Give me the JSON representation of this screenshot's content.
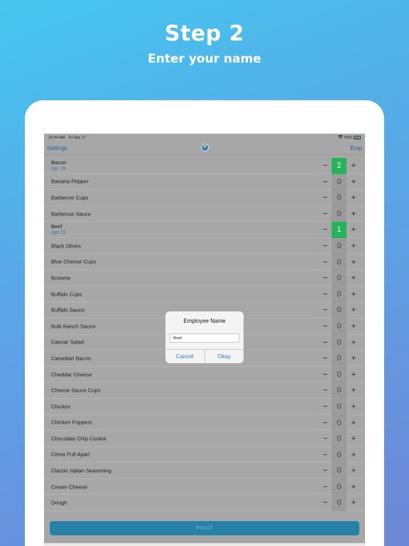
{
  "hero": {
    "title": "Step 2",
    "subtitle": "Enter your name"
  },
  "status_bar": {
    "time": "10:44 AM",
    "date": "Fri Apr 17",
    "battery": "59%"
  },
  "nav": {
    "left_label": "Settings",
    "right_label": "Emp"
  },
  "items": [
    {
      "name": "Bacon",
      "date": "Apr 16",
      "count": "2",
      "active": true
    },
    {
      "name": "Banana Pepper",
      "date": "",
      "count": "0",
      "active": false
    },
    {
      "name": "Barbecue Cups",
      "date": "",
      "count": "0",
      "active": false
    },
    {
      "name": "Barbecue Sauce",
      "date": "",
      "count": "0",
      "active": false
    },
    {
      "name": "Beef",
      "date": "Apr 15",
      "count": "1",
      "active": true
    },
    {
      "name": "Black Olives",
      "date": "",
      "count": "0",
      "active": false
    },
    {
      "name": "Blue Cheese Cups",
      "date": "",
      "count": "0",
      "active": false
    },
    {
      "name": "Brownie",
      "date": "",
      "count": "0",
      "active": false
    },
    {
      "name": "Buffalo Cups",
      "date": "",
      "count": "0",
      "active": false
    },
    {
      "name": "Buffalo Sauce",
      "date": "",
      "count": "0",
      "active": false
    },
    {
      "name": "Bulk Ranch Sauce",
      "date": "",
      "count": "0",
      "active": false
    },
    {
      "name": "Caesar Salad",
      "date": "",
      "count": "0",
      "active": false
    },
    {
      "name": "Canadian Bacon",
      "date": "",
      "count": "0",
      "active": false
    },
    {
      "name": "Cheddar Cheese",
      "date": "",
      "count": "0",
      "active": false
    },
    {
      "name": "Cheese Sauce Cups",
      "date": "",
      "count": "0",
      "active": false
    },
    {
      "name": "Chicken",
      "date": "",
      "count": "0",
      "active": false
    },
    {
      "name": "Chicken Poppers",
      "date": "",
      "count": "0",
      "active": false
    },
    {
      "name": "Chocolate Chip Cookie",
      "date": "",
      "count": "0",
      "active": false
    },
    {
      "name": "Cinna Pull Apart",
      "date": "",
      "count": "0",
      "active": false
    },
    {
      "name": "Classic Italian Seasoning",
      "date": "",
      "count": "0",
      "active": false
    },
    {
      "name": "Cream Cheese",
      "date": "",
      "count": "0",
      "active": false
    },
    {
      "name": "Dough",
      "date": "",
      "count": "0",
      "active": false
    }
  ],
  "stepper": {
    "minus": "−",
    "plus": "+"
  },
  "print_label": "PRINT",
  "dialog": {
    "title": "Employee Name",
    "input_value": "Mark",
    "cancel_label": "Cancel",
    "okay_label": "Okay"
  },
  "colors": {
    "active_count": "#27b35a",
    "link": "#1f5fa5",
    "print_button": "#2680a8"
  }
}
